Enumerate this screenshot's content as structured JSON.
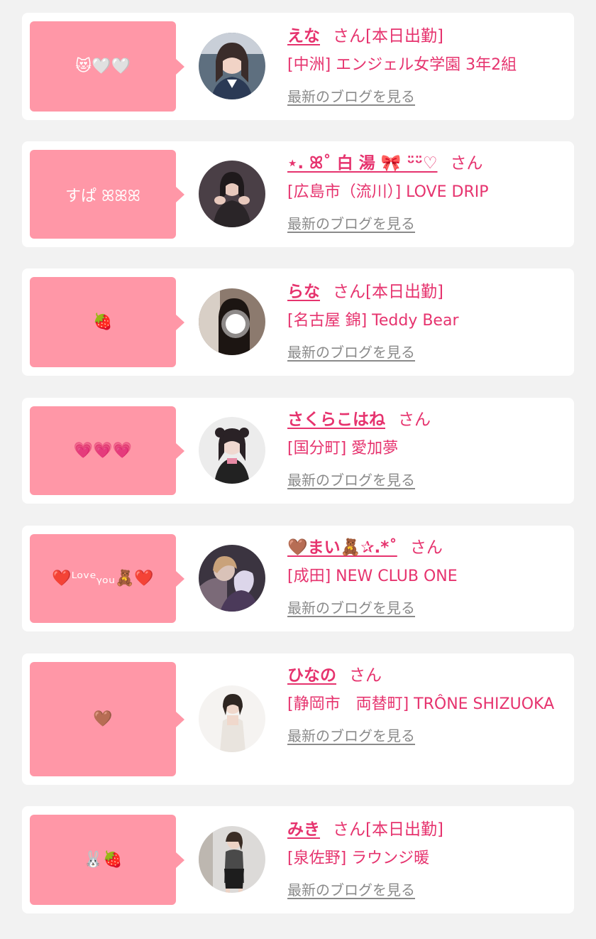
{
  "colors": {
    "accent": "#e6336e",
    "bubble": "#ff97a7",
    "link_gray": "#8a8a8a",
    "background": "#f2f2f2"
  },
  "entries": [
    {
      "bubble": "😻🤍🤍",
      "name": "えな",
      "suffix": "さん[本日出勤]",
      "shop": "[中洲] エンジェル女学園 3年2組",
      "blog_link": "最新のブログを見る"
    },
    {
      "bubble": "すぱ ꕤꕤꕤ",
      "name": "⋆. ꕤ˚ 白 湯 🎀 ᵕ̈ᵕ̈♡",
      "suffix": "さん",
      "shop": "[広島市（流川）] LOVE DRIP",
      "blog_link": "最新のブログを見る"
    },
    {
      "bubble": "🍓",
      "name": "らな",
      "suffix": "さん[本日出勤]",
      "shop": "[名古屋 錦] Teddy Bear",
      "blog_link": "最新のブログを見る"
    },
    {
      "bubble": "💗💗💗",
      "name": "さくらこはね",
      "suffix": "さん",
      "shop": "[国分町] 愛加夢",
      "blog_link": "最新のブログを見る"
    },
    {
      "bubble": "❤️ᴸᵒᵛᵉᵧₒᵤ🧸❤️",
      "name": "🤎まい🧸✰.*˚",
      "suffix": "さん",
      "shop": "[成田] NEW CLUB ONE",
      "blog_link": "最新のブログを見る"
    },
    {
      "bubble": "🤎",
      "name": "ひなの",
      "suffix": "さん",
      "shop": "[静岡市　両替町] TRÔNE SHIZUOKA",
      "blog_link": "最新のブログを見る"
    },
    {
      "bubble": "🐰🍓",
      "name": "みき",
      "suffix": "さん[本日出勤]",
      "shop": "[泉佐野] ラウンジ暖",
      "blog_link": "最新のブログを見る"
    }
  ]
}
